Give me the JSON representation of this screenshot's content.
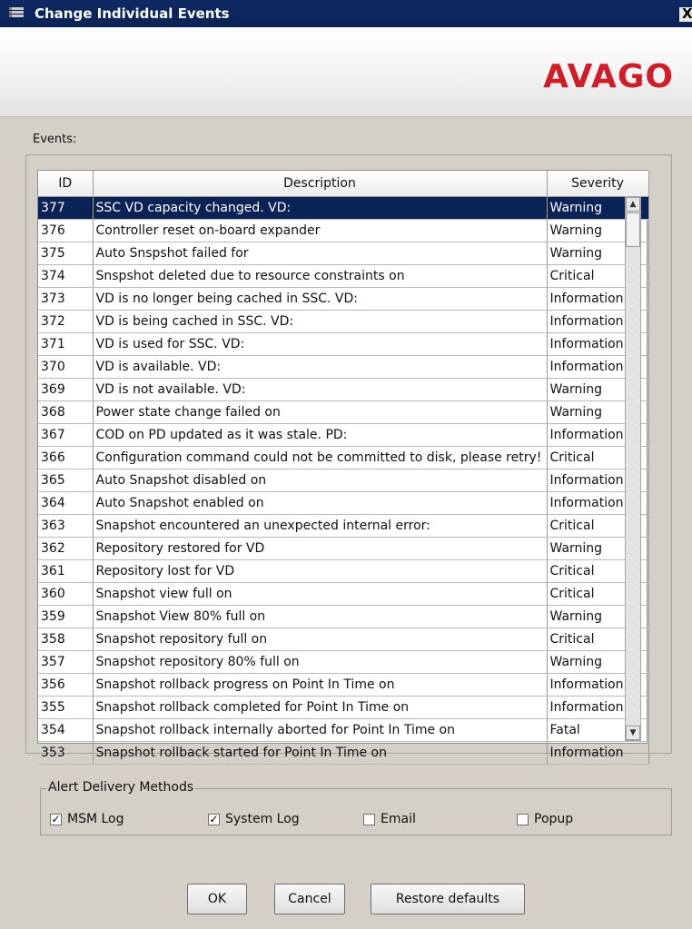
{
  "window": {
    "title": "Change Individual Events",
    "close_glyph": "X"
  },
  "banner": {
    "logo_text": "AVAGO"
  },
  "events": {
    "label": "Events:",
    "columns": [
      "ID",
      "Description",
      "Severity"
    ],
    "rows": [
      {
        "id": "377",
        "description": "SSC VD capacity changed. VD:",
        "severity": "Warning"
      },
      {
        "id": "376",
        "description": "Controller reset on-board expander",
        "severity": "Warning"
      },
      {
        "id": "375",
        "description": "Auto Snspshot failed for",
        "severity": "Warning"
      },
      {
        "id": "374",
        "description": "Snspshot deleted due to resource constraints on",
        "severity": "Critical"
      },
      {
        "id": "373",
        "description": "VD is no longer being cached in SSC. VD:",
        "severity": "Information"
      },
      {
        "id": "372",
        "description": "VD is being cached in SSC. VD:",
        "severity": "Information"
      },
      {
        "id": "371",
        "description": "VD is used for SSC. VD:",
        "severity": "Information"
      },
      {
        "id": "370",
        "description": "VD is available. VD:",
        "severity": "Information"
      },
      {
        "id": "369",
        "description": "VD is not available. VD:",
        "severity": "Warning"
      },
      {
        "id": "368",
        "description": "Power state change failed on",
        "severity": "Warning"
      },
      {
        "id": "367",
        "description": "COD on PD updated as it was stale. PD:",
        "severity": "Information"
      },
      {
        "id": "366",
        "description": "Configuration command could not be committed to disk, please retry!",
        "severity": "Critical"
      },
      {
        "id": "365",
        "description": "Auto Snapshot disabled on",
        "severity": "Information"
      },
      {
        "id": "364",
        "description": "Auto Snapshot enabled on",
        "severity": "Information"
      },
      {
        "id": "363",
        "description": "Snapshot encountered an unexpected internal error:",
        "severity": "Critical"
      },
      {
        "id": "362",
        "description": "Repository restored for VD",
        "severity": "Warning"
      },
      {
        "id": "361",
        "description": "Repository lost for VD",
        "severity": "Critical"
      },
      {
        "id": "360",
        "description": "Snapshot view full on",
        "severity": "Critical"
      },
      {
        "id": "359",
        "description": "Snapshot View 80% full on",
        "severity": "Warning"
      },
      {
        "id": "358",
        "description": "Snapshot repository full on",
        "severity": "Critical"
      },
      {
        "id": "357",
        "description": "Snapshot repository 80% full on",
        "severity": "Warning"
      },
      {
        "id": "356",
        "description": "Snapshot rollback progress on Point In Time on",
        "severity": "Information"
      },
      {
        "id": "355",
        "description": "Snapshot rollback completed for Point In Time on",
        "severity": "Information"
      },
      {
        "id": "354",
        "description": "Snapshot rollback internally aborted for Point In Time on",
        "severity": "Fatal"
      },
      {
        "id": "353",
        "description": "Snapshot rollback started for Point In Time on",
        "severity": "Information"
      }
    ],
    "selected_id": "377"
  },
  "alert_delivery": {
    "legend": "Alert Delivery Methods",
    "options": [
      {
        "label": "MSM Log",
        "checked": true
      },
      {
        "label": "System Log",
        "checked": true
      },
      {
        "label": "Email",
        "checked": false
      },
      {
        "label": "Popup",
        "checked": false
      }
    ]
  },
  "buttons": {
    "ok": "OK",
    "cancel": "Cancel",
    "restore": "Restore defaults"
  },
  "scrollbar": {
    "up_glyph": "▲",
    "down_glyph": "▼"
  },
  "check_glyph": "✓"
}
